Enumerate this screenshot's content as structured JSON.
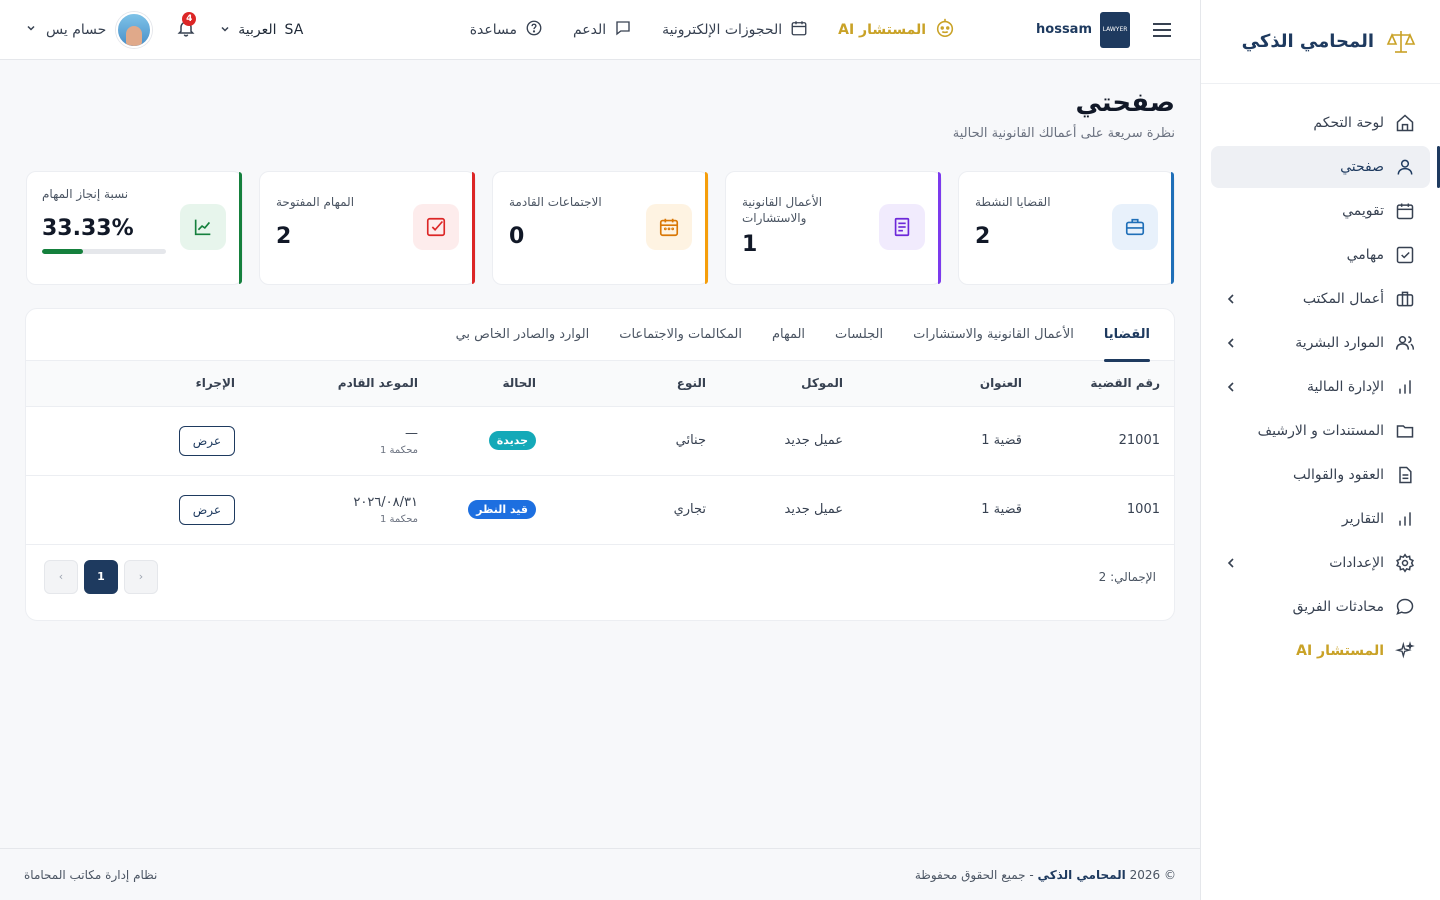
{
  "sidebar": {
    "brand": "المحامي الذكي",
    "items": [
      {
        "label": "لوحة التحكم"
      },
      {
        "label": "صفحتي"
      },
      {
        "label": "تقويمي"
      },
      {
        "label": "مهامي"
      },
      {
        "label": "أعمال المكتب"
      },
      {
        "label": "الموارد البشرية"
      },
      {
        "label": "الإدارة المالية"
      },
      {
        "label": "المستندات و الارشيف"
      },
      {
        "label": "العقود والقوالب"
      },
      {
        "label": "التقارير"
      },
      {
        "label": "الإعدادات"
      },
      {
        "label": "محادثات الفريق"
      },
      {
        "label": "المستشار AI"
      }
    ]
  },
  "topbar": {
    "app_user": "hossam",
    "logo_text": "LAWYER",
    "links": {
      "ai": "المستشار AI",
      "bookings": "الحجوزات الإلكترونية",
      "support": "الدعم",
      "help": "مساعدة"
    },
    "language": "العربية",
    "language_code": "SA",
    "notifications": "4",
    "user_name": "حسام يس"
  },
  "page": {
    "title": "صفحتي",
    "subtitle": "نظرة سريعة على أعمالك القانونية الحالية"
  },
  "stats": [
    {
      "label": "القضايا النشطة",
      "value": "2",
      "color": "#1f6fb8"
    },
    {
      "label": "الأعمال القانونية والاستشارات",
      "value": "1",
      "color": "#7c3aed"
    },
    {
      "label": "الاجتماعات القادمة",
      "value": "0",
      "color": "#f59e0b"
    },
    {
      "label": "المهام المفتوحة",
      "value": "2",
      "color": "#dc2626"
    },
    {
      "label": "نسبة إنجاز المهام",
      "value": "33.33%",
      "progress": 0.3333,
      "color": "#15803d"
    }
  ],
  "tabs": [
    "القضايا",
    "الأعمال القانونية والاستشارات",
    "الجلسات",
    "المهام",
    "المكالمات والاجتماعات",
    "الوارد والصادر الخاص بي"
  ],
  "table": {
    "headers": [
      "رقم القضية",
      "العنوان",
      "الموكل",
      "النوع",
      "الحالة",
      "الموعد القادم",
      "الإجراء"
    ],
    "rows": [
      {
        "number": "21001",
        "title": "قضية 1",
        "client": "عميل جديد",
        "type": "جنائي",
        "status": "جديدة",
        "next_date": "—",
        "court": "محكمة 1",
        "action": "عرض"
      },
      {
        "number": "1001",
        "title": "قضية 1",
        "client": "عميل جديد",
        "type": "تجاري",
        "status": "قيد النظر",
        "next_date": "٢٠٢٦/٠٨/٣١",
        "court": "محكمة 1",
        "action": "عرض"
      }
    ]
  },
  "pagination": {
    "total": "الإجمالي: 2",
    "prev": "‹",
    "current": "1",
    "next": "›"
  },
  "footer": {
    "copyright_prefix": "© 2026",
    "brand": "المحامي الذكي",
    "copyright_suffix": "- جميع الحقوق محفوظة",
    "system": "نظام إدارة مكاتب المحاماة"
  }
}
